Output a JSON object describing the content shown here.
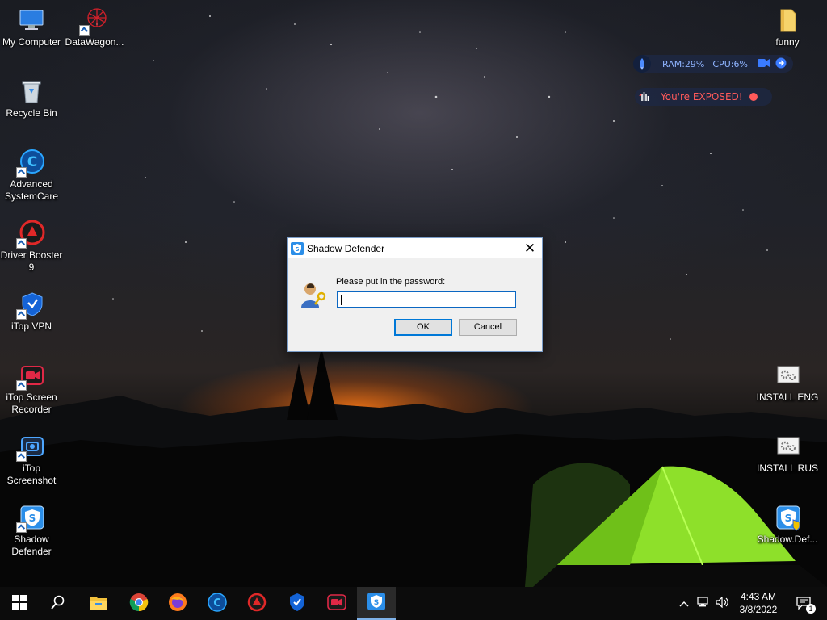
{
  "desktop": {
    "left_icons": [
      {
        "label": "My Computer",
        "icon": "computer-icon",
        "shortcut": false
      },
      {
        "label": "DataWagon...",
        "icon": "datawagon-icon",
        "shortcut": true
      },
      {
        "label": "Recycle Bin",
        "icon": "recycle-bin-icon",
        "shortcut": false
      },
      {
        "label": "Advanced SystemCare",
        "icon": "advanced-systemcare-icon",
        "shortcut": true
      },
      {
        "label": "Driver Booster 9",
        "icon": "driver-booster-icon",
        "shortcut": true
      },
      {
        "label": "iTop VPN",
        "icon": "itop-vpn-icon",
        "shortcut": true
      },
      {
        "label": "iTop Screen Recorder",
        "icon": "itop-screen-recorder-icon",
        "shortcut": true
      },
      {
        "label": "iTop Screenshot",
        "icon": "itop-screenshot-icon",
        "shortcut": true
      },
      {
        "label": "Shadow Defender",
        "icon": "shadow-defender-icon",
        "shortcut": true
      }
    ],
    "right_icons": [
      {
        "label": "funny",
        "icon": "folder-icon"
      },
      {
        "label": "INSTALL ENG",
        "icon": "settings-file-icon"
      },
      {
        "label": "INSTALL RUS",
        "icon": "settings-file-icon"
      },
      {
        "label": "Shadow.Def...",
        "icon": "shadow-defender-installer-icon"
      }
    ]
  },
  "widgets": {
    "system_monitor": {
      "ram_label": "RAM:",
      "ram_value": "29%",
      "cpu_label": "CPU:",
      "cpu_value": "6%",
      "accent": "#8fb4ff"
    },
    "vpn_status": {
      "text": "You're EXPOSED!",
      "color": "#ff5a5a",
      "icon": "exposed-hand-icon"
    }
  },
  "dialog": {
    "title": "Shadow Defender",
    "prompt": "Please put in the password:",
    "password_value": "",
    "ok_label": "OK",
    "cancel_label": "Cancel",
    "close_symbol": "✕",
    "icon": "user-key-icon"
  },
  "taskbar": {
    "pinned": [
      "start-icon",
      "search-icon",
      "file-explorer-icon",
      "chrome-icon",
      "firefox-icon",
      "advanced-systemcare-icon",
      "driver-booster-icon",
      "itop-vpn-icon",
      "itop-screen-recorder-icon",
      "shadow-defender-icon"
    ],
    "active_app": "shadow-defender-icon",
    "clock": {
      "time": "4:43 AM",
      "date": "3/8/2022"
    },
    "notification_count": "1"
  }
}
